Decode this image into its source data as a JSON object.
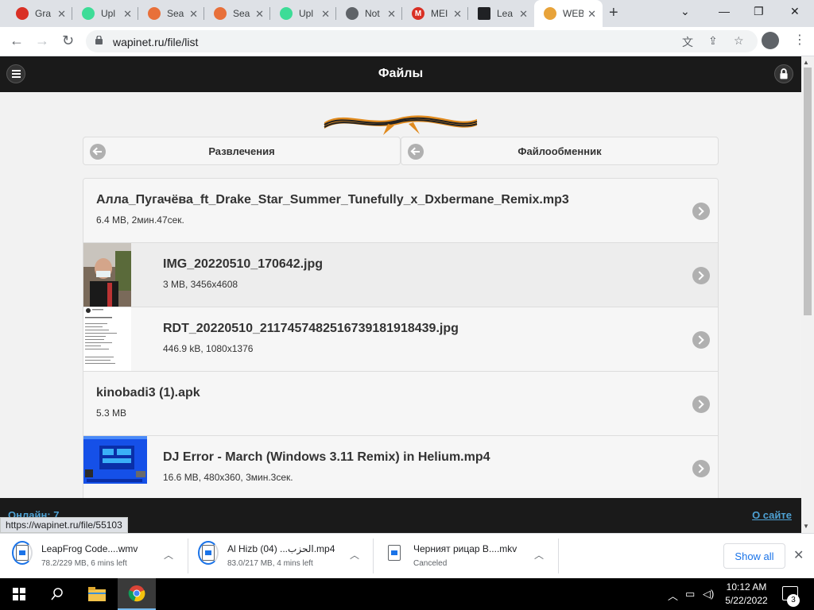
{
  "browser": {
    "tabs": [
      {
        "title": "Gra",
        "favicon": "red-lock-icon",
        "color": "#d93025"
      },
      {
        "title": "Upl",
        "favicon": "upload-cloud-icon",
        "color": "#3ddc97"
      },
      {
        "title": "Sea",
        "favicon": "person-icon",
        "color": "#e8703a"
      },
      {
        "title": "Sea",
        "favicon": "person-icon",
        "color": "#e8703a"
      },
      {
        "title": "Upl",
        "favicon": "upload-cloud-icon",
        "color": "#3ddc97"
      },
      {
        "title": "Not",
        "favicon": "globe-icon",
        "color": "#5f6368"
      },
      {
        "title": "MEI",
        "favicon": "m-icon",
        "color": "#d93025"
      },
      {
        "title": "Lea",
        "favicon": "library-icon",
        "color": "#202124"
      },
      {
        "title": "WEB",
        "favicon": "ribbon-icon",
        "color": "#e8a33a",
        "active": true
      }
    ],
    "url": "wapinet.ru/file/list",
    "status_url": "https://wapinet.ru/file/55103"
  },
  "site": {
    "header_title": "Файлы",
    "categories": [
      "Развлечения",
      "Файлообменник"
    ],
    "files": [
      {
        "name": "Алла_Пугачёва_ft_Drake_Star_Summer_Tunefully_x_Dxbermane_Remix.mp3",
        "meta": "6.4 MB, 2мин.47сек.",
        "thumb": "none"
      },
      {
        "name": "IMG_20220510_170642.jpg",
        "meta": "3 MB, 3456x4608",
        "thumb": "photo"
      },
      {
        "name": "RDT_20220510_2117457482516739181918439.jpg",
        "meta": "446.9 kB, 1080x1376",
        "thumb": "screenshot"
      },
      {
        "name": "kinobadi3 (1).apk",
        "meta": "5.3 MB",
        "thumb": "none"
      },
      {
        "name": "DJ Error - March (Windows 3.11 Remix) in Helium.mp4",
        "meta": "16.6 MB, 480x360, 3мин.3сек.",
        "thumb": "video"
      }
    ],
    "footer_online": "Онлайн: 7",
    "footer_about": "О сайте"
  },
  "downloads": [
    {
      "name": "LeapFrog Code....wmv",
      "status": "78.2/229 MB, 6 mins left"
    },
    {
      "name": "Al Hizb (04) ...الحزب.mp4",
      "status": "83.0/217 MB, 4 mins left"
    },
    {
      "name": "Черният рицар B....mkv",
      "status": "Canceled"
    }
  ],
  "downloads_show_all": "Show all",
  "taskbar": {
    "time": "10:12 AM",
    "date": "5/22/2022",
    "notifications": "3"
  }
}
